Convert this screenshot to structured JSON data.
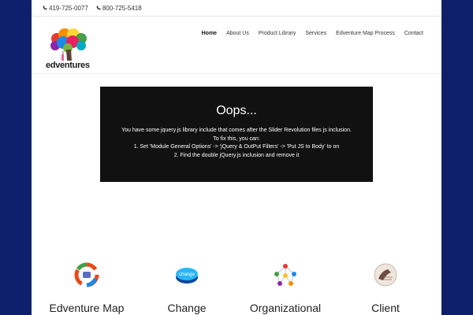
{
  "topbar": {
    "phone1": "419-725-0077",
    "phone2": "800-725-5418"
  },
  "logo": {
    "text": "edventures"
  },
  "nav": {
    "items": [
      {
        "label": "Home",
        "active": true
      },
      {
        "label": "About Us"
      },
      {
        "label": "Product Library"
      },
      {
        "label": "Services"
      },
      {
        "label": "Edventure Map Process"
      },
      {
        "label": "Contact"
      }
    ]
  },
  "error": {
    "title": "Oops...",
    "line1": "You have some jquery.js library include that comes after the Slider Revolution files js inclusion.",
    "line2": "To fix this, you can:",
    "line3": "1. Set 'Module General Options' -> 'jQuery & OutPut Filters' -> 'Put JS to Body' to on",
    "line4": "2. Find the double jQuery.js inclusion and remove it"
  },
  "features": [
    {
      "label": "Edventure Map",
      "icon": "cycle-arrows-icon"
    },
    {
      "label": "Change",
      "icon": "change-button-icon"
    },
    {
      "label": "Organizational",
      "icon": "people-network-icon"
    },
    {
      "label": "Client",
      "icon": "testimonial-ball-icon"
    }
  ],
  "colors": {
    "background": "#0e1f6b",
    "error_box": "#111111"
  }
}
